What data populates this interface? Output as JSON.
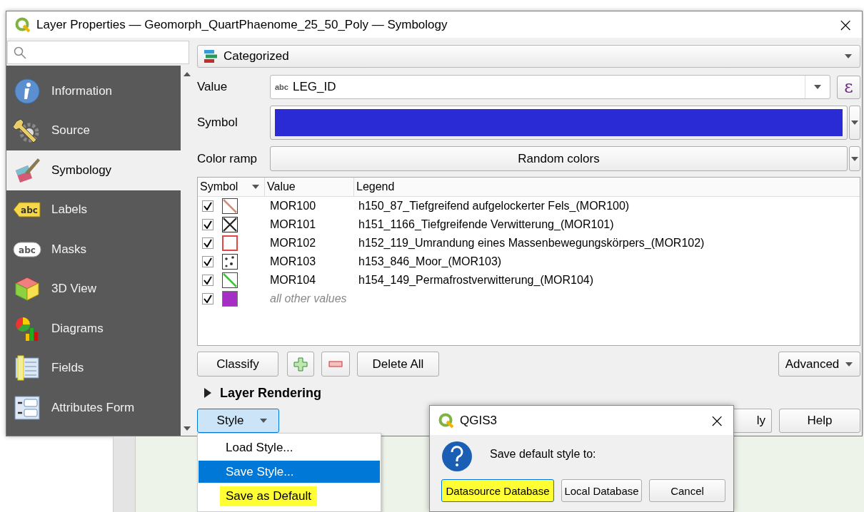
{
  "window": {
    "title": "Layer Properties — Geomorph_QuartPhaenome_25_50_Poly — Symbology",
    "close": "×"
  },
  "sidebar": {
    "items": [
      {
        "label": "Information",
        "kind": "information",
        "selected": false
      },
      {
        "label": "Source",
        "kind": "source",
        "selected": false
      },
      {
        "label": "Symbology",
        "kind": "symbology",
        "selected": true
      },
      {
        "label": "Labels",
        "kind": "labels",
        "icon_text": "abc",
        "selected": false
      },
      {
        "label": "Masks",
        "kind": "masks",
        "icon_text": "abc",
        "selected": false
      },
      {
        "label": "3D View",
        "kind": "view3d",
        "selected": false
      },
      {
        "label": "Diagrams",
        "kind": "diagrams",
        "selected": false
      },
      {
        "label": "Fields",
        "kind": "fields",
        "selected": false
      },
      {
        "label": "Attributes Form",
        "kind": "attributes_form",
        "selected": false
      }
    ]
  },
  "renderer": {
    "value": "Categorized"
  },
  "value_field": {
    "label": "Value",
    "type_badge": "abc",
    "value": "LEG_ID",
    "expression_button": "ε"
  },
  "symbol": {
    "label": "Symbol",
    "color": "#2b2bd6"
  },
  "color_ramp": {
    "label": "Color ramp",
    "value": "Random colors"
  },
  "table": {
    "columns": [
      {
        "label": "Symbol",
        "sorted": true
      },
      {
        "label": "Value",
        "sorted": false
      },
      {
        "label": "Legend",
        "sorted": false
      }
    ],
    "rows": [
      {
        "kind": "category",
        "checked": true,
        "symbol": {
          "kind": "diagonal",
          "color": "#c8907c"
        },
        "value": "MOR100",
        "legend": "h150_87_Tiefgreifend aufgelockerter Fels_(MOR100)"
      },
      {
        "kind": "category",
        "checked": true,
        "symbol": {
          "kind": "cross",
          "color": "#222222"
        },
        "value": "MOR101",
        "legend": "h151_1166_Tiefgreifende Verwitterung_(MOR101)"
      },
      {
        "kind": "category",
        "checked": true,
        "symbol": {
          "kind": "outline",
          "color": "#e04848"
        },
        "value": "MOR102",
        "legend": "h152_119_Umrandung eines Massenbewegungskörpers_(MOR102)"
      },
      {
        "kind": "category",
        "checked": true,
        "symbol": {
          "kind": "dots",
          "color": "#333333"
        },
        "value": "MOR103",
        "legend": "h153_846_Moor_(MOR103)"
      },
      {
        "kind": "category",
        "checked": true,
        "symbol": {
          "kind": "diagonal",
          "color": "#40c040"
        },
        "value": "MOR104",
        "legend": "h154_149_Permafrostverwitterung_(MOR104)"
      },
      {
        "kind": "other",
        "checked": true,
        "symbol": {
          "kind": "fill",
          "color": "#a52fc4"
        },
        "value": "all other values"
      }
    ]
  },
  "classify_buttons": {
    "classify": "Classify",
    "delete_all": "Delete All",
    "advanced": "Advanced"
  },
  "layer_rendering": {
    "label": "Layer Rendering",
    "expanded": false
  },
  "bottom_buttons": {
    "style": {
      "label": "Style",
      "open": true
    },
    "apply_visible": "ly",
    "help": "Help"
  },
  "style_menu": {
    "items": [
      {
        "label": "Load Style...",
        "selected": false,
        "highlighted": false
      },
      {
        "label": "Save Style...",
        "selected": true,
        "highlighted": false
      },
      {
        "label": "Save as Default",
        "selected": false,
        "highlighted": true
      }
    ]
  },
  "message_box": {
    "title": "QGIS3",
    "close": "×",
    "message": "Save default style to:",
    "buttons": [
      {
        "label": "Datasource Database",
        "default": true,
        "highlighted": true
      },
      {
        "label": "Local Database",
        "default": false,
        "highlighted": false
      },
      {
        "label": "Cancel",
        "default": false,
        "highlighted": false
      }
    ]
  }
}
